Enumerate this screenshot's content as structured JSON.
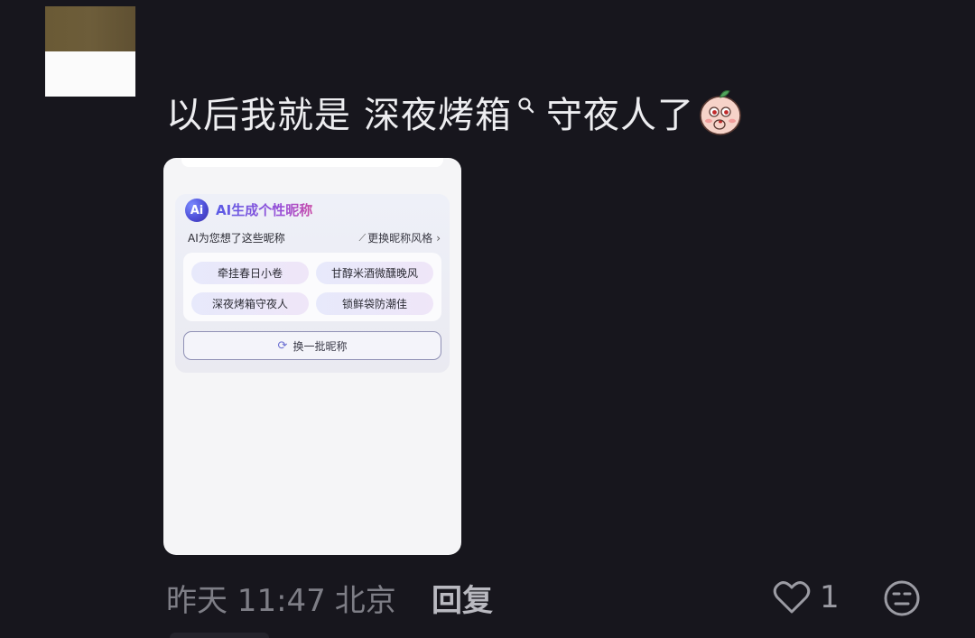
{
  "comment": {
    "text_before": "以后我就是",
    "link_text": "深夜烤箱",
    "text_after": "守夜人了",
    "search_icon": "search-icon",
    "emoji": "blushing-peach-emoji"
  },
  "screenshot": {
    "top_text": "",
    "panel": {
      "logo_text": "Ai",
      "title": "AI生成个性昵称",
      "subtitle": "AI为您想了这些昵称",
      "change_style": "更换昵称风格",
      "nicknames": [
        "牵挂春日小卷",
        "甘醇米酒微醺晚风",
        "深夜烤箱守夜人",
        "锁鲜袋防潮佳"
      ],
      "refresh_label": "换一批昵称"
    }
  },
  "footer": {
    "time": "昨天 11:47",
    "location": "北京",
    "reply_label": "回复",
    "like_count": "1",
    "like_icon": "heart-icon",
    "dislike_icon": "meh-face-icon"
  },
  "colors": {
    "background": "#17161d",
    "text": "#ededf0",
    "meta": "#7e7e86",
    "accent": "#5a5be6"
  }
}
